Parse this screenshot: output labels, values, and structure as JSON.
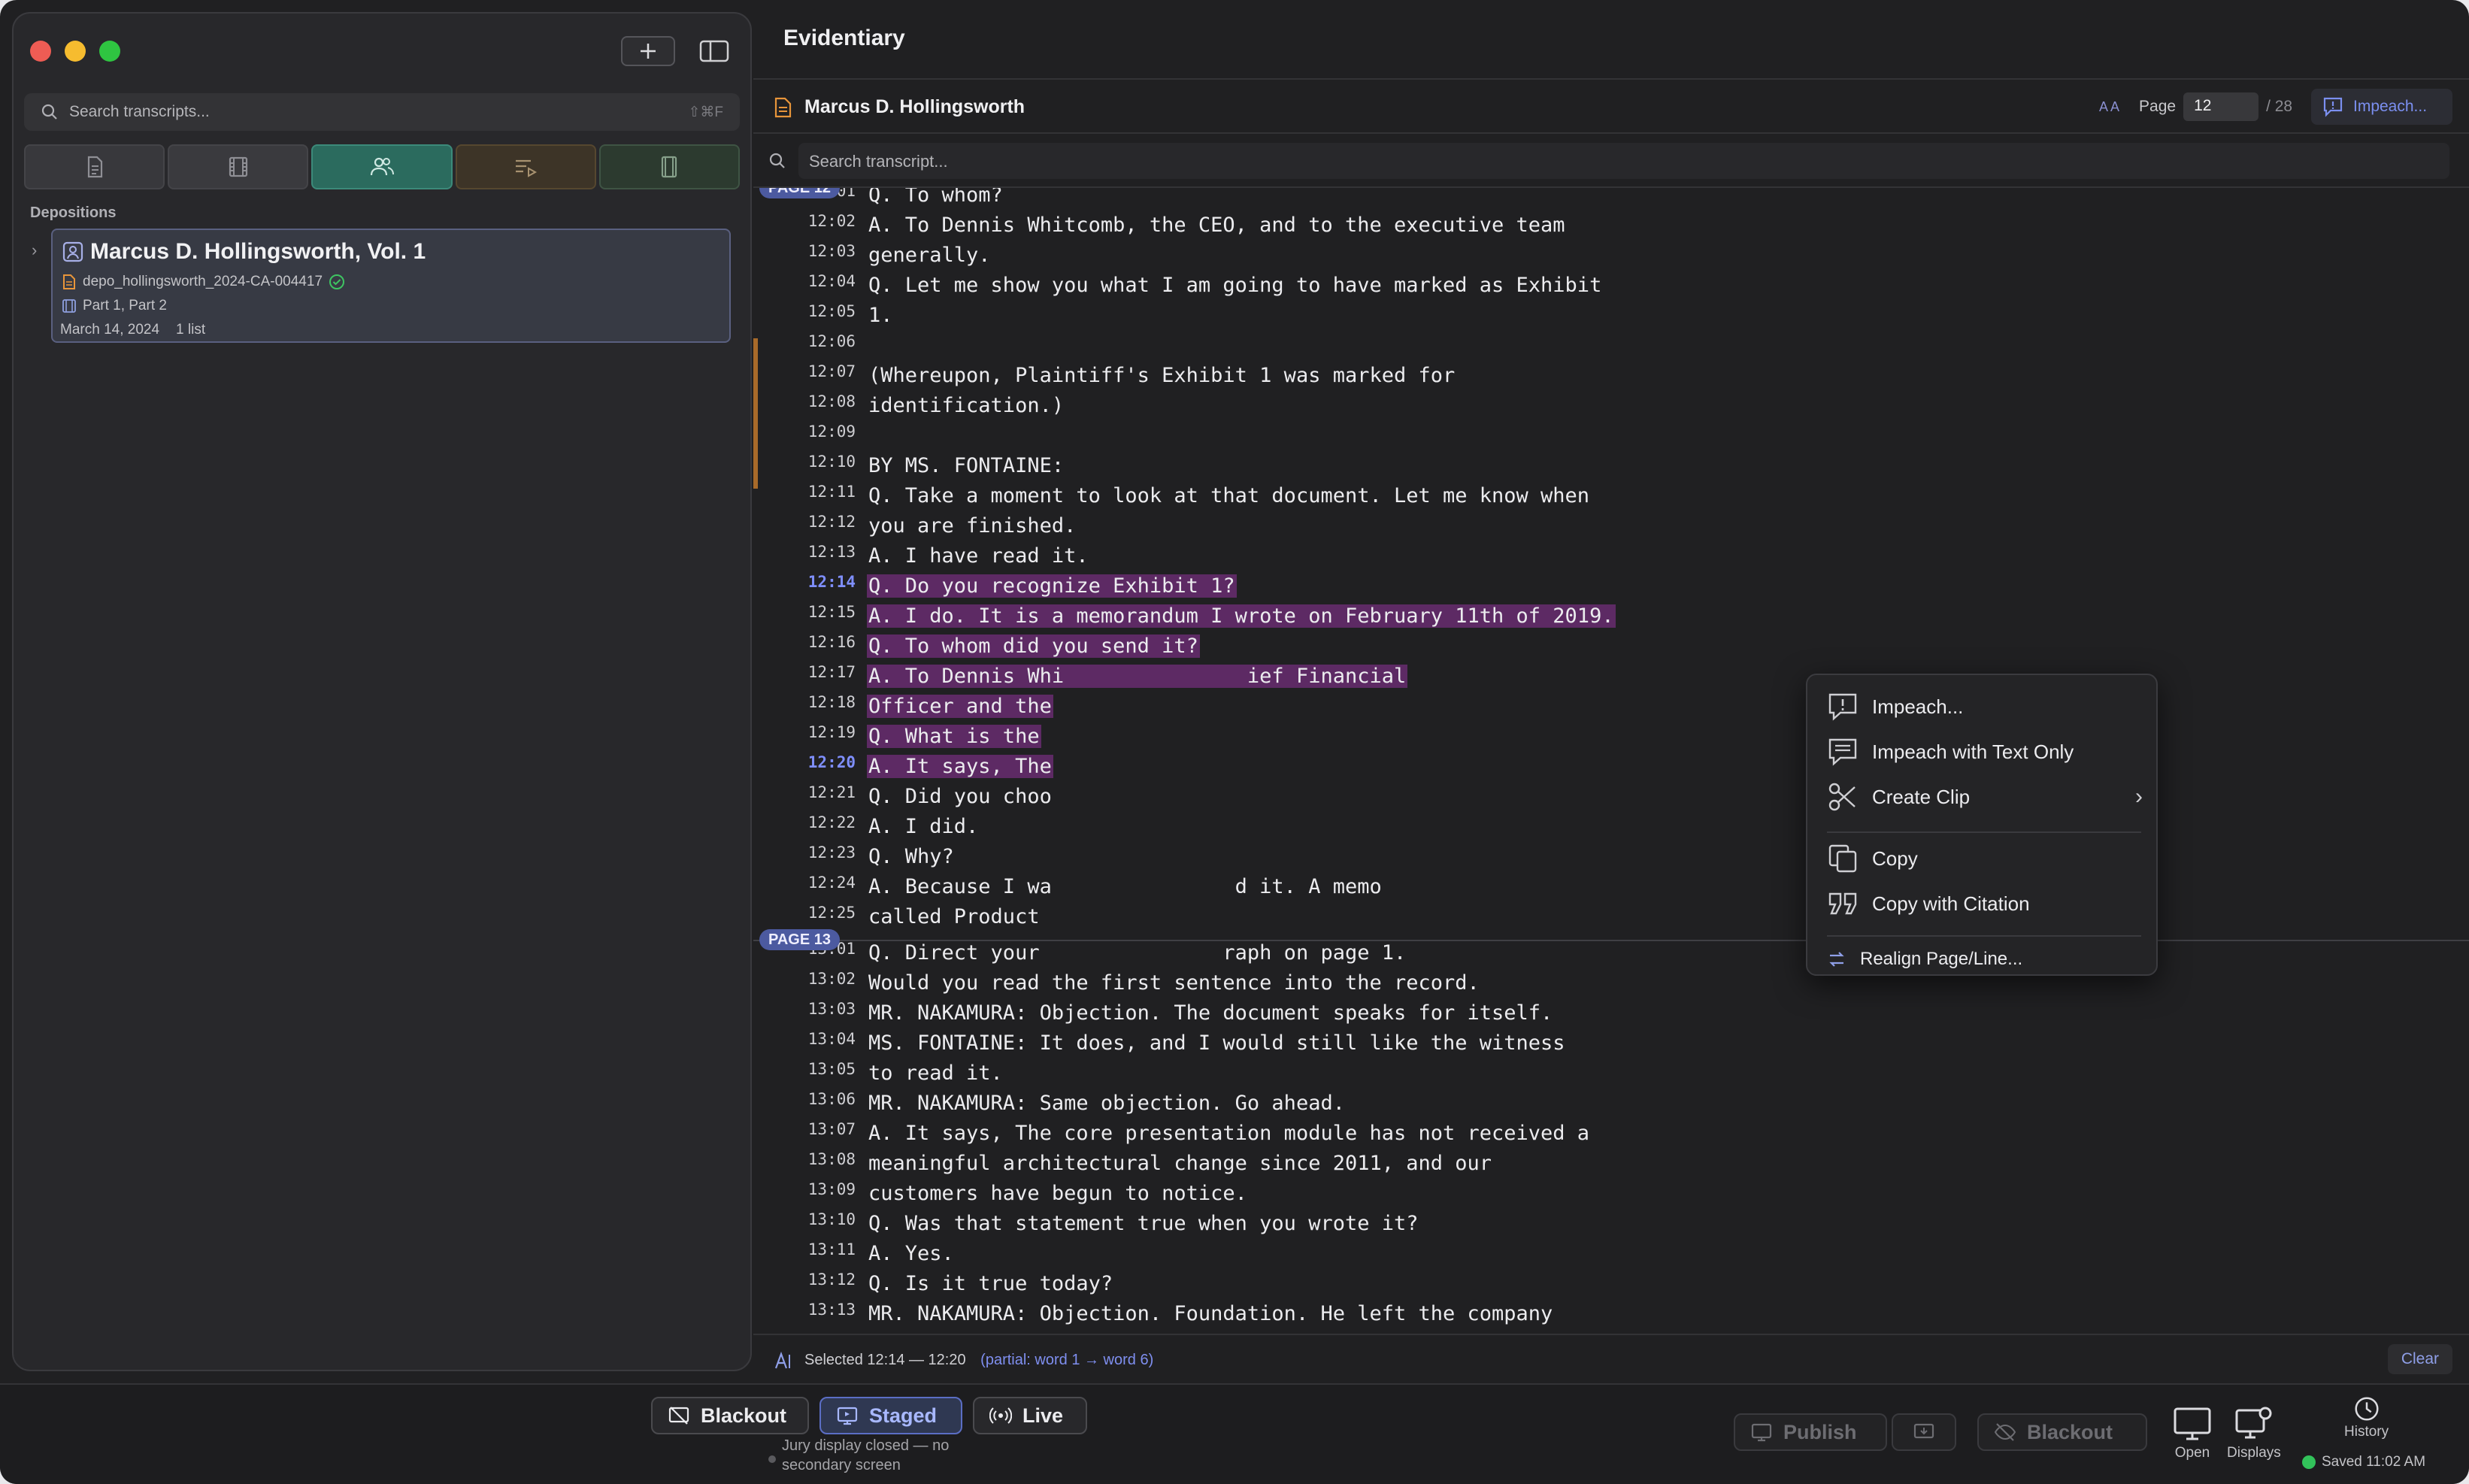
{
  "app": {
    "title": "Evidentiary"
  },
  "sidebar": {
    "search_placeholder": "Search transcripts...",
    "search_shortcut": "⇧⌘F",
    "section_label": "Depositions",
    "deposition": {
      "title": "Marcus D. Hollingsworth, Vol. 1",
      "file": "depo_hollingsworth_2024-CA-004417",
      "parts": "Part 1, Part 2",
      "date": "March 14, 2024",
      "lists": "1 list"
    }
  },
  "document": {
    "name": "Marcus D. Hollingsworth",
    "font_size_label": "A A",
    "page_label": "Page",
    "page_value": "12",
    "page_total": "/ 28",
    "impeach_button": "Impeach...",
    "search_placeholder": "Search transcript..."
  },
  "transcript": {
    "page12_badge": "PAGE 12",
    "page13_badge": "PAGE 13",
    "lines": [
      {
        "n": "12:01",
        "t": "Q. To whom?",
        "sel": false,
        "hl": false
      },
      {
        "n": "12:02",
        "t": "A. To Dennis Whitcomb, the CEO, and to the executive team",
        "sel": false,
        "hl": false
      },
      {
        "n": "12:03",
        "t": "generally.",
        "sel": false,
        "hl": false
      },
      {
        "n": "12:04",
        "t": "Q. Let me show you what I am going to have marked as Exhibit",
        "sel": false,
        "hl": false
      },
      {
        "n": "12:05",
        "t": "1.",
        "sel": false,
        "hl": false
      },
      {
        "n": "12:06",
        "t": "",
        "sel": false,
        "hl": false
      },
      {
        "n": "12:07",
        "t": "(Whereupon, Plaintiff's Exhibit 1 was marked for",
        "sel": false,
        "hl": false
      },
      {
        "n": "12:08",
        "t": "identification.)",
        "sel": false,
        "hl": false
      },
      {
        "n": "12:09",
        "t": "",
        "sel": false,
        "hl": false
      },
      {
        "n": "12:10",
        "t": "BY MS. FONTAINE:",
        "sel": false,
        "hl": false
      },
      {
        "n": "12:11",
        "t": "Q. Take a moment to look at that document. Let me know when",
        "sel": false,
        "hl": false
      },
      {
        "n": "12:12",
        "t": "you are finished.",
        "sel": false,
        "hl": false
      },
      {
        "n": "12:13",
        "t": "A. I have read it.",
        "sel": false,
        "hl": false
      },
      {
        "n": "12:14",
        "t": "Q. Do you recognize Exhibit 1?",
        "sel": true,
        "hl": true
      },
      {
        "n": "12:15",
        "t": "A. I do. It is a memorandum I wrote on February 11th of 2019.",
        "sel": true,
        "hl": false
      },
      {
        "n": "12:16",
        "t": "Q. To whom did you send it?",
        "sel": true,
        "hl": false
      },
      {
        "n": "12:17",
        "t": "A. To Dennis Whi               ief Financial",
        "sel": true,
        "hl": false
      },
      {
        "n": "12:18",
        "t": "Officer and the",
        "sel": true,
        "hl": false
      },
      {
        "n": "12:19",
        "t": "Q. What is the",
        "sel": true,
        "hl": false
      },
      {
        "n": "12:20",
        "t": "A. It says, The",
        "sel": true,
        "hl": true
      },
      {
        "n": "12:21",
        "t": "Q. Did you choo",
        "sel": false,
        "hl": false
      },
      {
        "n": "12:22",
        "t": "A. I did.",
        "sel": false,
        "hl": false
      },
      {
        "n": "12:23",
        "t": "Q. Why?",
        "sel": false,
        "hl": false
      },
      {
        "n": "12:24",
        "t": "A. Because I wa               d it. A memo",
        "sel": false,
        "hl": false
      },
      {
        "n": "12:25",
        "t": "called Product",
        "sel": false,
        "hl": false
      },
      {
        "n": "13:01",
        "t": "Q. Direct your               raph on page 1.",
        "sel": false,
        "hl": false
      },
      {
        "n": "13:02",
        "t": "Would you read the first sentence into the record.",
        "sel": false,
        "hl": false
      },
      {
        "n": "13:03",
        "t": "MR. NAKAMURA: Objection. The document speaks for itself.",
        "sel": false,
        "hl": false
      },
      {
        "n": "13:04",
        "t": "MS. FONTAINE: It does, and I would still like the witness",
        "sel": false,
        "hl": false
      },
      {
        "n": "13:05",
        "t": "to read it.",
        "sel": false,
        "hl": false
      },
      {
        "n": "13:06",
        "t": "MR. NAKAMURA: Same objection. Go ahead.",
        "sel": false,
        "hl": false
      },
      {
        "n": "13:07",
        "t": "A. It says, The core presentation module has not received a",
        "sel": false,
        "hl": false
      },
      {
        "n": "13:08",
        "t": "meaningful architectural change since 2011, and our",
        "sel": false,
        "hl": false
      },
      {
        "n": "13:09",
        "t": "customers have begun to notice.",
        "sel": false,
        "hl": false
      },
      {
        "n": "13:10",
        "t": "Q. Was that statement true when you wrote it?",
        "sel": false,
        "hl": false
      },
      {
        "n": "13:11",
        "t": "A. Yes.",
        "sel": false,
        "hl": false
      },
      {
        "n": "13:12",
        "t": "Q. Is it true today?",
        "sel": false,
        "hl": false
      },
      {
        "n": "13:13",
        "t": "MR. NAKAMURA: Objection. Foundation. He left the company",
        "sel": false,
        "hl": false
      }
    ]
  },
  "context_menu": {
    "impeach": "Impeach...",
    "impeach_text": "Impeach with Text Only",
    "create_clip": "Create Clip",
    "copy": "Copy",
    "copy_citation": "Copy with Citation",
    "realign": "Realign Page/Line..."
  },
  "status": {
    "selected": "Selected 12:14 — 12:20",
    "partial": "(partial: word 1 → word 6)",
    "clear": "Clear"
  },
  "bottom": {
    "blackout": "Blackout",
    "staged": "Staged",
    "live": "Live",
    "jury_note_1": "Jury display closed — no",
    "jury_note_2": "secondary screen",
    "publish": "Publish",
    "blackout2": "Blackout",
    "open": "Open",
    "displays": "Displays",
    "history": "History",
    "saved": "Saved 11:02 AM"
  },
  "colors": {
    "accent": "#7b8ff0",
    "selection": "#5d2a64",
    "staged": "#2f3852",
    "teal_tab": "#2b6b5e"
  }
}
